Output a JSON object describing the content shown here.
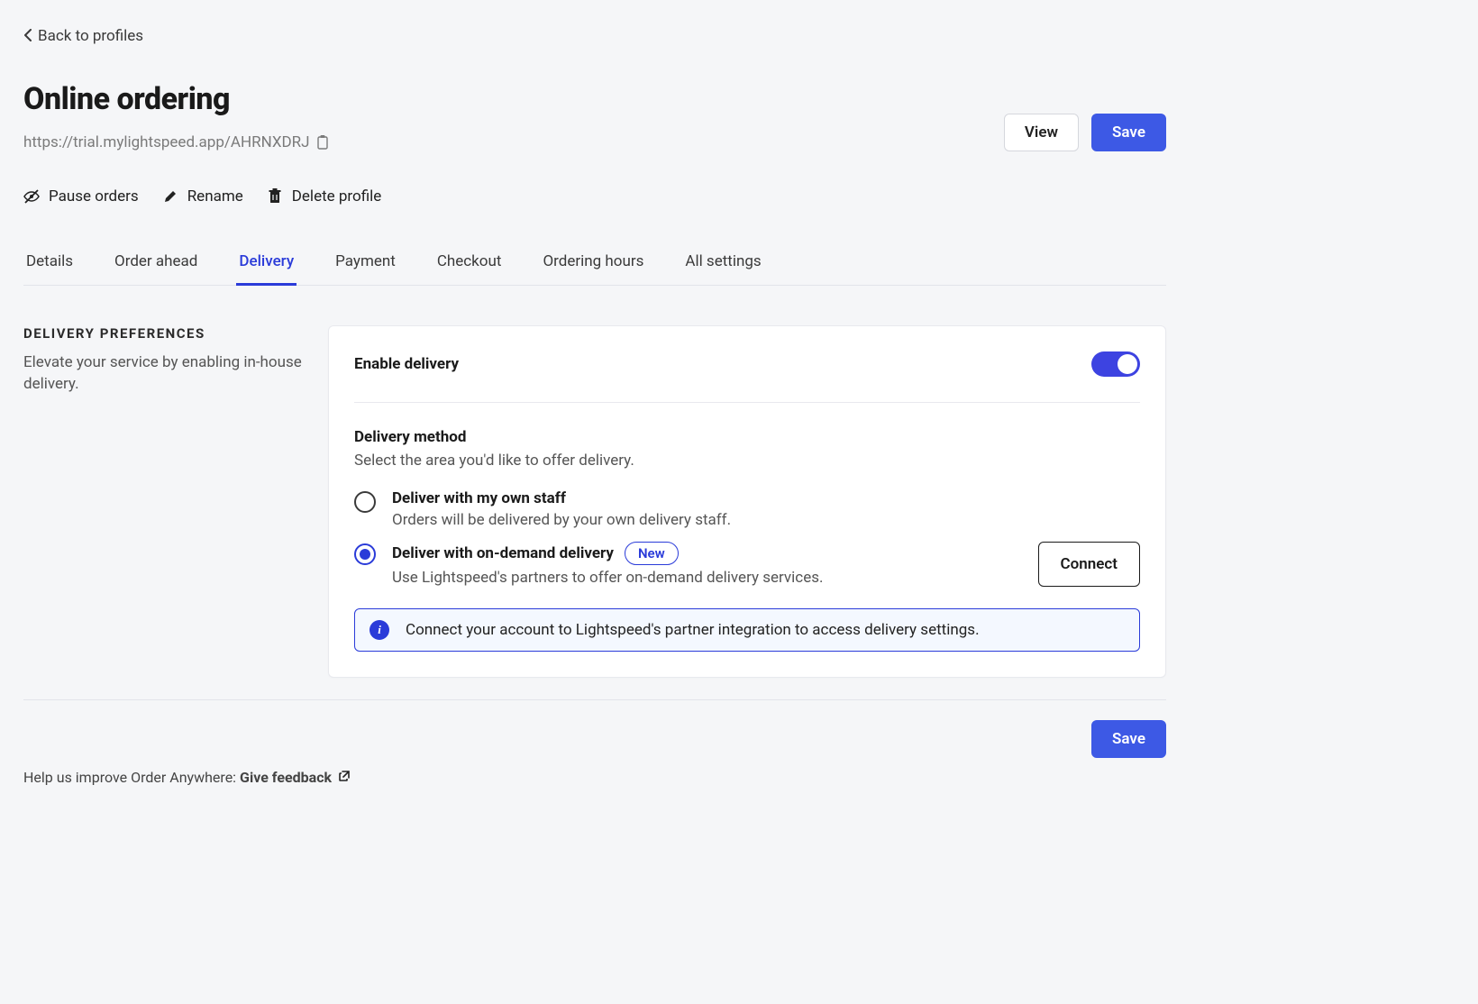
{
  "back_label": "Back to profiles",
  "title": "Online ordering",
  "profile_url": "https://trial.mylightspeed.app/AHRNXDRJ",
  "buttons": {
    "view": "View",
    "save": "Save",
    "connect": "Connect"
  },
  "toolbar": {
    "pause": "Pause orders",
    "rename": "Rename",
    "delete": "Delete profile"
  },
  "tabs": [
    {
      "id": "details",
      "label": "Details",
      "active": false
    },
    {
      "id": "order-ahead",
      "label": "Order ahead",
      "active": false
    },
    {
      "id": "delivery",
      "label": "Delivery",
      "active": true
    },
    {
      "id": "payment",
      "label": "Payment",
      "active": false
    },
    {
      "id": "checkout",
      "label": "Checkout",
      "active": false
    },
    {
      "id": "ordering-hours",
      "label": "Ordering hours",
      "active": false
    },
    {
      "id": "all-settings",
      "label": "All settings",
      "active": false
    }
  ],
  "section": {
    "label": "DELIVERY PREFERENCES",
    "desc": "Elevate your service by enabling in-house delivery."
  },
  "enable": {
    "label": "Enable delivery",
    "on": true
  },
  "method": {
    "title": "Delivery method",
    "sub": "Select the area you'd like to offer delivery.",
    "options": [
      {
        "id": "own-staff",
        "label": "Deliver with my own staff",
        "desc": "Orders will be delivered by your own delivery staff.",
        "selected": false,
        "badge": null
      },
      {
        "id": "on-demand",
        "label": "Deliver with on-demand delivery",
        "desc": "Use Lightspeed's partners to offer on-demand delivery services.",
        "selected": true,
        "badge": "New"
      }
    ]
  },
  "info_banner": "Connect your account to Lightspeed's partner integration to access delivery settings.",
  "feedback": {
    "prefix": "Help us improve Order Anywhere: ",
    "link": "Give feedback"
  }
}
